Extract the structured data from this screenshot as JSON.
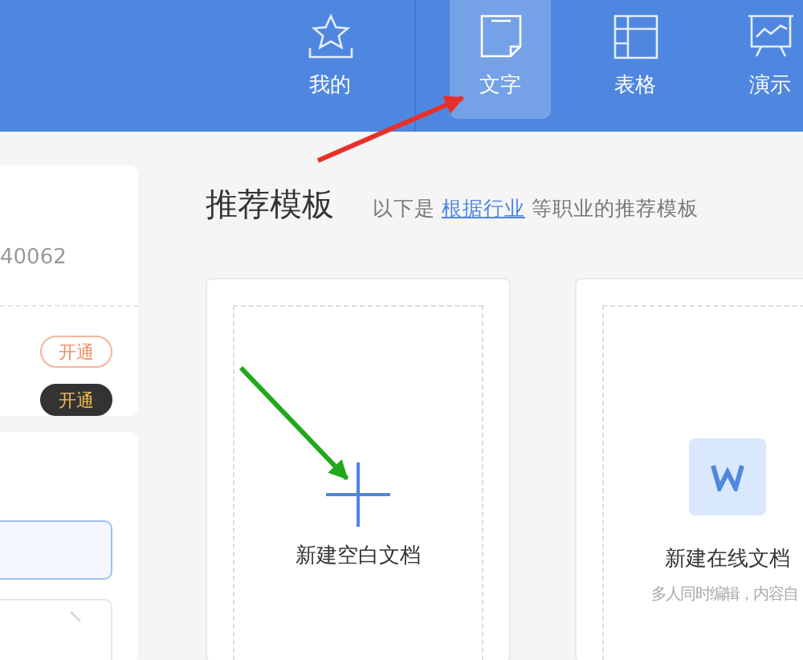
{
  "tabs": [
    {
      "label": "我的",
      "kind": "mine",
      "selected": false
    },
    {
      "label": "文字",
      "kind": "writer",
      "selected": true
    },
    {
      "label": "表格",
      "kind": "sheet",
      "selected": false
    },
    {
      "label": "演示",
      "kind": "slides",
      "selected": false
    }
  ],
  "account": {
    "number": "40062",
    "buttons": [
      {
        "label": "开通",
        "kind": "outline"
      },
      {
        "label": "开通",
        "kind": "dark"
      }
    ]
  },
  "templates": {
    "title": "推荐模板",
    "intro": "以下是",
    "link": "根据行业",
    "outro": "等职业的推荐模板"
  },
  "cards": [
    {
      "kind": "blank",
      "label": "新建空白文档"
    },
    {
      "kind": "online",
      "label": "新建在线文档",
      "note": "多人同时编辑，内容自"
    }
  ]
}
